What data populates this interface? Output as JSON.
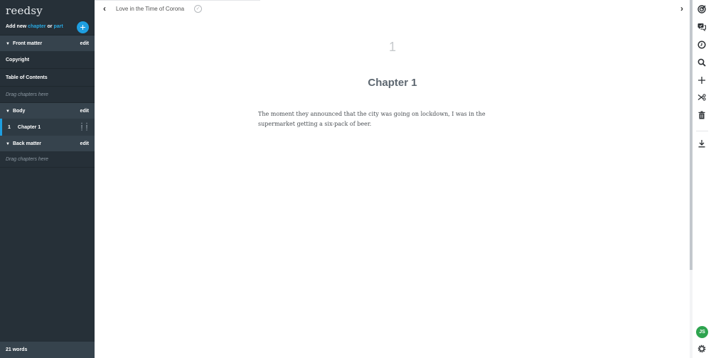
{
  "sidebar": {
    "logo": "reedsy",
    "add_new": {
      "prefix": "Add new",
      "chapter_link": "chapter",
      "or": "or",
      "part_link": "part",
      "button_icon": "+"
    },
    "front_matter": {
      "title": "Front matter",
      "edit": "edit",
      "items": [
        "Copyright",
        "Table of Contents"
      ],
      "drop_hint": "Drag chapters here"
    },
    "body": {
      "title": "Body",
      "edit": "edit",
      "chapters": [
        {
          "number": "1",
          "title": "Chapter 1",
          "active": true
        }
      ]
    },
    "back_matter": {
      "title": "Back matter",
      "edit": "edit",
      "drop_hint": "Drag chapters here"
    },
    "word_count": "21 words"
  },
  "header": {
    "back_icon": "‹",
    "book_title": "Love in the Time of Corona",
    "saved_icon": "✓",
    "forward_icon": "›"
  },
  "editor": {
    "chapter_number": "1",
    "chapter_title": "Chapter 1",
    "body_text": "The moment they announced that the city was going on lockdown, I was in the supermarket getting a six-pack of beer."
  },
  "toolbar": {
    "tools": [
      "goals",
      "comments",
      "history",
      "search",
      "add",
      "split",
      "delete",
      "export"
    ],
    "avatar_initials": "JS",
    "colors": {
      "accent": "#1e9ee0",
      "avatar": "#2ea44f",
      "sidebar": "#263038"
    }
  }
}
